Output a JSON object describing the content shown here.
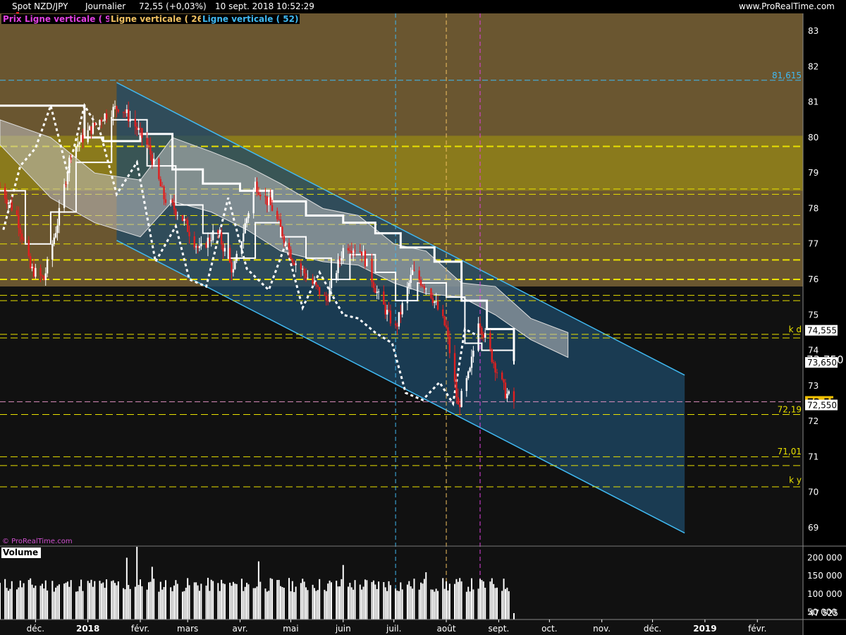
{
  "header": {
    "symbol": "Spot NZD/JPY",
    "period": "Journalier",
    "last": "72,55 (+0,03%)",
    "datetime": "10 sept. 2018 10:52:29",
    "site": "www.ProRealTime.com"
  },
  "legend": [
    {
      "text": "Prix",
      "color": "#e040e0"
    },
    {
      "text": "Ligne verticale ( 9)",
      "color": "#e040e0"
    },
    {
      "text": "Ligne verticale ( 26)",
      "color": "#f0c060"
    },
    {
      "text": "Ligne verticale ( 52)",
      "color": "#40b8f0"
    }
  ],
  "watermark": "© ProRealTime.com",
  "volume_title": "Volume",
  "colors": {
    "background": "#111111",
    "zone_brown": "#6a5630",
    "zone_olive": "#8a7a1c",
    "channel": "#40b8f0",
    "channel_fill": "#1e4a68",
    "bull": "#ffffff",
    "bear": "#e02020",
    "cloud": "#c0c0c0",
    "hline": "#e8e000",
    "cyan_line": "#40b8f0",
    "magenta": "#e040e0",
    "orange": "#f0c060"
  },
  "chart_data": {
    "type": "candlestick",
    "x_axis": {
      "labels": [
        "déc.",
        "2018",
        "févr.",
        "mars",
        "avr.",
        "mai",
        "juin",
        "juil.",
        "août",
        "sept.",
        "oct.",
        "nov.",
        "déc.",
        "2019",
        "févr."
      ],
      "range": [
        "2017-11-10",
        "2019-02-28"
      ]
    },
    "y_axis": {
      "range": [
        68.5,
        83.5
      ],
      "ticks": [
        69,
        70,
        71,
        72,
        73,
        74,
        75,
        76,
        77,
        78,
        79,
        80,
        81,
        82,
        83
      ],
      "tick_labels": [
        "69",
        "70",
        "71",
        "72",
        "73",
        "74",
        "75",
        "76",
        "77",
        "78",
        "79",
        "80",
        "81",
        "82",
        "83"
      ]
    },
    "price_labels": [
      {
        "text": "74,555",
        "value": 74.555,
        "style": "white"
      },
      {
        "text": "73,750",
        "value": 73.75,
        "style": "large"
      },
      {
        "text": "73,650",
        "value": 73.65,
        "style": "white"
      },
      {
        "text": "72,55",
        "value": 72.55,
        "style": "gold"
      },
      {
        "text": "72,550",
        "value": 72.45,
        "style": "white"
      }
    ],
    "level_labels": [
      {
        "text": "81,615",
        "value": 81.615,
        "color": "#40b8f0"
      },
      {
        "text": "k d",
        "value": 74.45,
        "color": "#e8e000"
      },
      {
        "text": "72,19",
        "value": 72.19,
        "color": "#e8e000"
      },
      {
        "text": "71,01",
        "value": 71.01,
        "color": "#e8e000"
      },
      {
        "text": "k y",
        "value": 70.2,
        "color": "#e8e000"
      }
    ],
    "horizontal_lines": [
      81.615,
      79.75,
      78.55,
      78.4,
      77.8,
      77.55,
      77.0,
      76.55,
      76.0,
      75.55,
      75.4,
      74.45,
      74.35,
      72.55,
      72.19,
      71.0,
      70.75,
      70.15
    ],
    "zones": [
      {
        "from": 75.8,
        "to": 83.5,
        "color": "zone_brown"
      },
      {
        "from": 78.5,
        "to": 80.05,
        "color": "zone_olive"
      }
    ],
    "vertical_lines": [
      {
        "date": "2018-07-02",
        "color": "#40b8f0"
      },
      {
        "date": "2018-08-01",
        "color": "#f0c060"
      },
      {
        "date": "2018-08-21",
        "color": "#e040e0"
      }
    ],
    "channel": {
      "top": [
        [
          "2018-01-18",
          81.55
        ],
        [
          "2018-12-20",
          73.3
        ]
      ],
      "bottom": [
        [
          "2018-01-18",
          77.1
        ],
        [
          "2018-12-20",
          68.85
        ]
      ]
    },
    "price_path": [
      [
        "2017-11-10",
        78.6
      ],
      [
        "2017-11-20",
        77.8
      ],
      [
        "2017-11-28",
        76.3
      ],
      [
        "2017-12-06",
        76.0
      ],
      [
        "2017-12-14",
        77.6
      ],
      [
        "2017-12-22",
        79.6
      ],
      [
        "2017-12-31",
        80.1
      ],
      [
        "2018-01-10",
        80.6
      ],
      [
        "2018-01-20",
        80.9
      ],
      [
        "2018-01-28",
        80.4
      ],
      [
        "2018-02-06",
        79.7
      ],
      [
        "2018-02-15",
        78.3
      ],
      [
        "2018-02-25",
        77.8
      ],
      [
        "2018-03-08",
        76.8
      ],
      [
        "2018-03-18",
        77.4
      ],
      [
        "2018-03-28",
        76.2
      ],
      [
        "2018-04-10",
        78.7
      ],
      [
        "2018-04-20",
        78.0
      ],
      [
        "2018-05-02",
        76.6
      ],
      [
        "2018-05-12",
        76.0
      ],
      [
        "2018-05-22",
        75.4
      ],
      [
        "2018-06-02",
        77.0
      ],
      [
        "2018-06-12",
        76.8
      ],
      [
        "2018-06-22",
        75.5
      ],
      [
        "2018-07-02",
        74.6
      ],
      [
        "2018-07-12",
        76.2
      ],
      [
        "2018-07-22",
        75.7
      ],
      [
        "2018-08-01",
        74.6
      ],
      [
        "2018-08-08",
        72.4
      ],
      [
        "2018-08-15",
        73.4
      ],
      [
        "2018-08-20",
        74.9
      ],
      [
        "2018-08-28",
        73.8
      ],
      [
        "2018-09-05",
        72.8
      ],
      [
        "2018-09-10",
        72.55
      ]
    ],
    "ichimoku_cloud": {
      "upper": [
        [
          "2017-11-10",
          80.5
        ],
        [
          "2017-12-10",
          80.0
        ],
        [
          "2018-01-05",
          79.0
        ],
        [
          "2018-02-01",
          78.8
        ],
        [
          "2018-02-20",
          80.0
        ],
        [
          "2018-03-15",
          79.6
        ],
        [
          "2018-04-05",
          79.2
        ],
        [
          "2018-04-25",
          78.7
        ],
        [
          "2018-05-20",
          78.0
        ],
        [
          "2018-06-10",
          77.8
        ],
        [
          "2018-07-01",
          77.0
        ],
        [
          "2018-07-20",
          76.8
        ],
        [
          "2018-08-10",
          75.9
        ],
        [
          "2018-08-30",
          75.8
        ],
        [
          "2018-09-20",
          74.9
        ],
        [
          "2018-10-12",
          74.5
        ]
      ],
      "lower": [
        [
          "2017-11-10",
          79.8
        ],
        [
          "2017-12-10",
          78.3
        ],
        [
          "2018-01-05",
          77.6
        ],
        [
          "2018-02-01",
          77.2
        ],
        [
          "2018-02-20",
          78.2
        ],
        [
          "2018-03-15",
          77.9
        ],
        [
          "2018-04-05",
          77.4
        ],
        [
          "2018-04-25",
          76.8
        ],
        [
          "2018-05-20",
          76.5
        ],
        [
          "2018-06-10",
          76.4
        ],
        [
          "2018-07-01",
          75.9
        ],
        [
          "2018-07-20",
          75.6
        ],
        [
          "2018-08-10",
          75.5
        ],
        [
          "2018-08-30",
          75.0
        ],
        [
          "2018-09-20",
          74.3
        ],
        [
          "2018-10-12",
          73.8
        ]
      ]
    },
    "kijun_path": [
      [
        "2017-11-10",
        80.9
      ],
      [
        "2017-12-10",
        80.9
      ],
      [
        "2017-12-30",
        80.0
      ],
      [
        "2018-01-10",
        79.9
      ],
      [
        "2018-02-01",
        80.1
      ],
      [
        "2018-02-20",
        79.1
      ],
      [
        "2018-03-10",
        78.7
      ],
      [
        "2018-04-01",
        78.5
      ],
      [
        "2018-04-20",
        78.2
      ],
      [
        "2018-05-10",
        77.8
      ],
      [
        "2018-06-01",
        77.6
      ],
      [
        "2018-06-20",
        77.3
      ],
      [
        "2018-07-05",
        76.9
      ],
      [
        "2018-07-25",
        76.5
      ],
      [
        "2018-08-10",
        75.4
      ],
      [
        "2018-08-25",
        74.6
      ],
      [
        "2018-09-10",
        73.7
      ]
    ],
    "tenkan_path": [
      [
        "2017-11-10",
        78.5
      ],
      [
        "2017-11-25",
        77.0
      ],
      [
        "2017-12-10",
        77.9
      ],
      [
        "2017-12-25",
        79.3
      ],
      [
        "2018-01-15",
        80.5
      ],
      [
        "2018-02-05",
        79.2
      ],
      [
        "2018-02-22",
        78.1
      ],
      [
        "2018-03-10",
        77.3
      ],
      [
        "2018-03-25",
        76.6
      ],
      [
        "2018-04-10",
        77.6
      ],
      [
        "2018-04-25",
        77.2
      ],
      [
        "2018-05-10",
        76.6
      ],
      [
        "2018-05-25",
        76.0
      ],
      [
        "2018-06-05",
        76.7
      ],
      [
        "2018-06-20",
        76.2
      ],
      [
        "2018-07-02",
        75.4
      ],
      [
        "2018-07-15",
        75.9
      ],
      [
        "2018-08-01",
        75.5
      ],
      [
        "2018-08-12",
        74.2
      ],
      [
        "2018-08-22",
        74.0
      ],
      [
        "2018-09-10",
        73.6
      ]
    ],
    "lagging_path": [
      [
        "2017-11-12",
        77.4
      ],
      [
        "2017-11-22",
        79.2
      ],
      [
        "2017-12-01",
        79.7
      ],
      [
        "2017-12-10",
        80.9
      ],
      [
        "2017-12-20",
        79.0
      ],
      [
        "2017-12-30",
        80.9
      ],
      [
        "2018-01-08",
        80.2
      ],
      [
        "2018-01-18",
        78.4
      ],
      [
        "2018-01-30",
        79.3
      ],
      [
        "2018-02-10",
        76.5
      ],
      [
        "2018-02-22",
        77.5
      ],
      [
        "2018-03-02",
        76.0
      ],
      [
        "2018-03-12",
        75.8
      ],
      [
        "2018-03-25",
        78.3
      ],
      [
        "2018-04-05",
        76.3
      ],
      [
        "2018-04-18",
        75.7
      ],
      [
        "2018-04-28",
        77.0
      ],
      [
        "2018-05-08",
        75.2
      ],
      [
        "2018-05-18",
        76.2
      ],
      [
        "2018-06-01",
        75.0
      ],
      [
        "2018-06-10",
        74.9
      ],
      [
        "2018-06-20",
        74.5
      ],
      [
        "2018-06-30",
        74.2
      ],
      [
        "2018-07-08",
        72.8
      ],
      [
        "2018-07-18",
        72.6
      ],
      [
        "2018-07-28",
        73.1
      ],
      [
        "2018-08-05",
        72.5
      ],
      [
        "2018-08-12",
        74.6
      ],
      [
        "2018-08-20",
        74.4
      ]
    ],
    "volume": {
      "y_axis": {
        "range": [
          30000,
          230000
        ],
        "ticks": [
          50000,
          100000,
          150000,
          200000
        ],
        "tick_labels": [
          "50 000",
          "100 000",
          "150 000",
          "200 000"
        ]
      },
      "last_label": "47 525",
      "last_value": 47525,
      "range": [
        "2017-11-10",
        "2018-09-10"
      ],
      "typical": 125000,
      "spikes": [
        [
          "2018-01-30",
          230000
        ],
        [
          "2018-01-24",
          200000
        ],
        [
          "2018-04-12",
          190000
        ],
        [
          "2018-06-01",
          180000
        ],
        [
          "2018-02-08",
          175000
        ],
        [
          "2018-07-20",
          160000
        ]
      ]
    }
  }
}
